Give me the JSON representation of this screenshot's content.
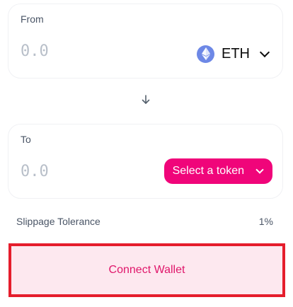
{
  "swap": {
    "from": {
      "label": "From",
      "amount_placeholder": "0.0",
      "token_symbol": "ETH",
      "token_icon": "ethereum-icon"
    },
    "to": {
      "label": "To",
      "amount_placeholder": "0.0",
      "select_token_label": "Select a token"
    },
    "slippage": {
      "label": "Slippage Tolerance",
      "value": "1%"
    },
    "connect_wallet_label": "Connect Wallet"
  },
  "colors": {
    "accent": "#f0057a",
    "connect_button_bg": "#fde8ef",
    "connect_button_text": "#e0176b",
    "highlight_border": "#e51d2c",
    "eth_icon": "#6d88e6"
  }
}
